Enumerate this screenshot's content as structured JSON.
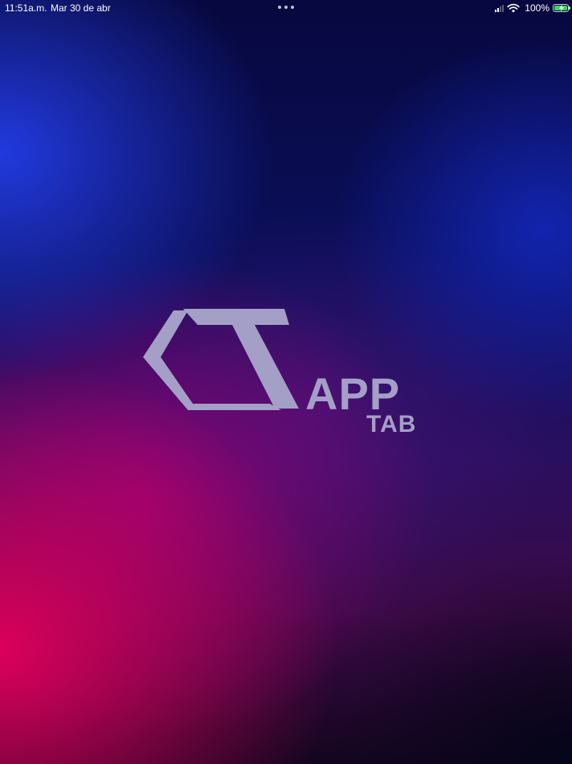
{
  "status_bar": {
    "time": "11:51a.m.",
    "date": "Mar 30 de abr",
    "battery_percent": "100%",
    "battery_level": 1.0,
    "battery_charging": true,
    "wifi": "wifi-icon",
    "signal": "cellular-signal-icon"
  },
  "splash": {
    "logo_word_app": "APP",
    "logo_word_tab": "TAB",
    "logo_icon": "ct-logo-mark"
  },
  "colors": {
    "logo": "#a49fc6",
    "battery": "#3bd45a"
  }
}
